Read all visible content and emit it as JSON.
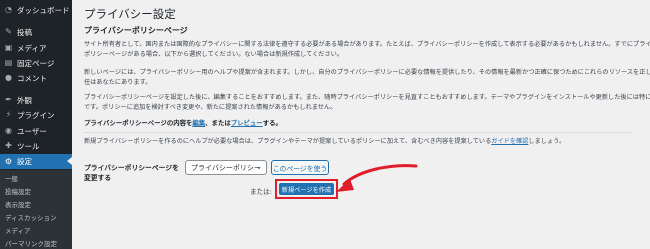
{
  "sidebar": {
    "items": [
      {
        "label": "ダッシュボード",
        "icon": "dashboard-icon"
      },
      {
        "label": "投稿",
        "icon": "pin-icon"
      },
      {
        "label": "メディア",
        "icon": "media-icon"
      },
      {
        "label": "固定ページ",
        "icon": "page-icon"
      },
      {
        "label": "コメント",
        "icon": "comment-icon"
      },
      {
        "label": "外観",
        "icon": "brush-icon"
      },
      {
        "label": "プラグイン",
        "icon": "plugin-icon"
      },
      {
        "label": "ユーザー",
        "icon": "user-icon"
      },
      {
        "label": "ツール",
        "icon": "wrench-icon"
      },
      {
        "label": "設定",
        "icon": "settings-icon"
      }
    ],
    "submenu": [
      "一般",
      "投稿設定",
      "表示設定",
      "ディスカッション",
      "メディア",
      "パーマリンク設定"
    ]
  },
  "page": {
    "title": "プライバシー設定",
    "section_title": "プライバシーポリシーページ",
    "p1_line1": "サイト所有者として、国内または国際的なプライバシーに関する法律を遵守する必要がある場合があります。たとえば、プライバシーポリシーを作成して表示する必要があるかもしれません。すでにプライバシー",
    "p1_line2": "ポリシーページがある場合、以下から選択してください。ない場合は新規作成してください。",
    "p2_line1": "新しいページには、プライバシーポリシー用のヘルプや提案が含まれます。しかし、自分のプライバシーポリシーに必要な情報を提供したり、その情報を最新かつ正確に保つためにこれらのリソースを正しく責",
    "p2_line2": "任はあなたにあります。",
    "p3_line1": "プライバシーポリシーページを設定した後に、編集することをおすすめします。また、随時プライバシーポリシーを見直すこともおすすめします。テーマやプラグインをインストールや更新した後には特にそう",
    "p3_line2": "です。ポリシーに追加を検討すべき変更や、新たに提案された情報があるかもしれません。",
    "edit_line_prefix": "プライバシーポリシーページの内容を",
    "edit_link": "編集",
    "edit_mid": "、または",
    "preview_link": "プレビュー",
    "edit_suffix": "する。",
    "guide_prefix": "新規プライバシーポリシーを作るのにヘルプが必要な場合は、プラグインやテーマが提案しているポリシーに加えて、含むべき内容を提案している",
    "guide_link": "ガイドを確認",
    "guide_suffix": "しましょう。",
    "form_label_1": "プライバシーポリシーページを",
    "form_label_2": "変更する",
    "select_value": "プライバシーポリシー",
    "use_button": "このページを使う",
    "or_label": "または:",
    "create_button": "新規ページを作成"
  },
  "colors": {
    "accent": "#2271b1",
    "highlight": "#e11d2a",
    "sidebar": "#1d2327"
  }
}
